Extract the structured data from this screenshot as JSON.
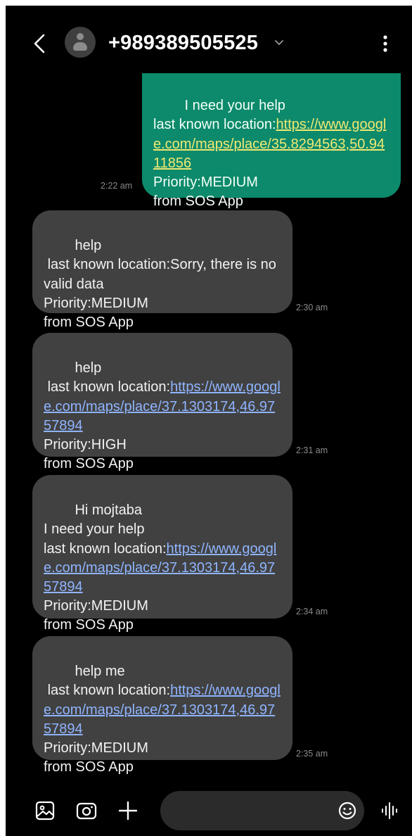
{
  "header": {
    "title": "+989389505525",
    "icons": [
      "back-arrow-icon",
      "contact-avatar-icon",
      "chevron-down-icon",
      "more-vert-icon"
    ]
  },
  "messages": [
    {
      "direction": "outgoing",
      "parts": [
        {
          "text": "I need your help\nlast known location:"
        },
        {
          "text": "https://www.google.com/maps/place/35.8294563,50.9411856",
          "link": true
        },
        {
          "text": "\nPriority:MEDIUM\nfrom SOS App"
        }
      ],
      "time": "2:22 am"
    },
    {
      "direction": "incoming",
      "parts": [
        {
          "text": "help\n last known location:Sorry, there is no valid data\nPriority:MEDIUM\nfrom SOS App"
        }
      ],
      "time": "2:30 am"
    },
    {
      "direction": "incoming",
      "parts": [
        {
          "text": "help\n last known location:"
        },
        {
          "text": "https://www.google.com/maps/place/37.1303174,46.9757894",
          "link": true
        },
        {
          "text": "\nPriority:HIGH\nfrom SOS App"
        }
      ],
      "time": "2:31 am"
    },
    {
      "direction": "incoming",
      "parts": [
        {
          "text": "Hi mojtaba\nI need your help\nlast known location:"
        },
        {
          "text": "https://www.google.com/maps/place/37.1303174,46.9757894",
          "link": true
        },
        {
          "text": "\nPriority:MEDIUM\nfrom SOS App"
        }
      ],
      "time": "2:34 am"
    },
    {
      "direction": "incoming",
      "parts": [
        {
          "text": "help me\n last known location:"
        },
        {
          "text": "https://www.google.com/maps/place/37.1303174,46.9757894",
          "link": true
        },
        {
          "text": "\nPriority:MEDIUM\nfrom SOS App"
        }
      ],
      "time": "2:35 am"
    }
  ],
  "composer": {
    "input_value": "",
    "icons": [
      "gallery-icon",
      "camera-icon",
      "add-icon",
      "emoji-icon",
      "voice-icon"
    ]
  },
  "colors": {
    "background": "#000000",
    "incoming_bubble": "#414141",
    "outgoing_bubble": "#0c8a6b",
    "incoming_link": "#8fb4ff",
    "outgoing_link": "#f1e873"
  }
}
